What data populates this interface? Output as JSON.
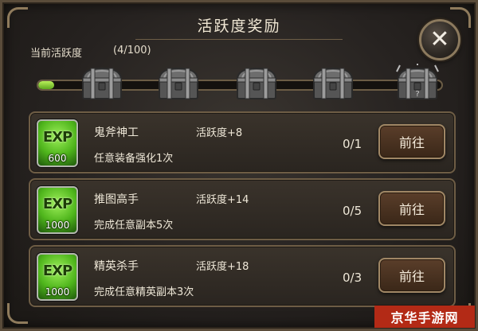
{
  "title": "活跃度奖励",
  "close_icon": "close-x-icon",
  "activity": {
    "label": "当前活跃度",
    "count_text": "(4/100)",
    "progress_fraction": 0.04
  },
  "chests": [
    {
      "icon": "chest-icon",
      "state": "locked"
    },
    {
      "icon": "chest-icon",
      "state": "locked"
    },
    {
      "icon": "chest-icon",
      "state": "locked"
    },
    {
      "icon": "chest-icon",
      "state": "locked"
    },
    {
      "icon": "mystery-chest-icon",
      "state": "locked"
    }
  ],
  "tasks": [
    {
      "name": "鬼斧神工",
      "activity": "活跃度+8",
      "desc": "任意装备强化1次",
      "exp_label": "EXP",
      "exp_amount": "600",
      "progress": "0/1",
      "button": "前往"
    },
    {
      "name": "推图高手",
      "activity": "活跃度+14",
      "desc": "完成任意副本5次",
      "exp_label": "EXP",
      "exp_amount": "1000",
      "progress": "0/5",
      "button": "前往"
    },
    {
      "name": "精英杀手",
      "activity": "活跃度+18",
      "desc": "完成任意精英副本3次",
      "exp_label": "EXP",
      "exp_amount": "1000",
      "progress": "0/3",
      "button": "前往"
    }
  ],
  "watermark": "京华手游网",
  "colors": {
    "progress": "#7ed334",
    "exp_icon": "#5fbd22",
    "button": "#4a3220",
    "watermark": "#b32a16"
  }
}
